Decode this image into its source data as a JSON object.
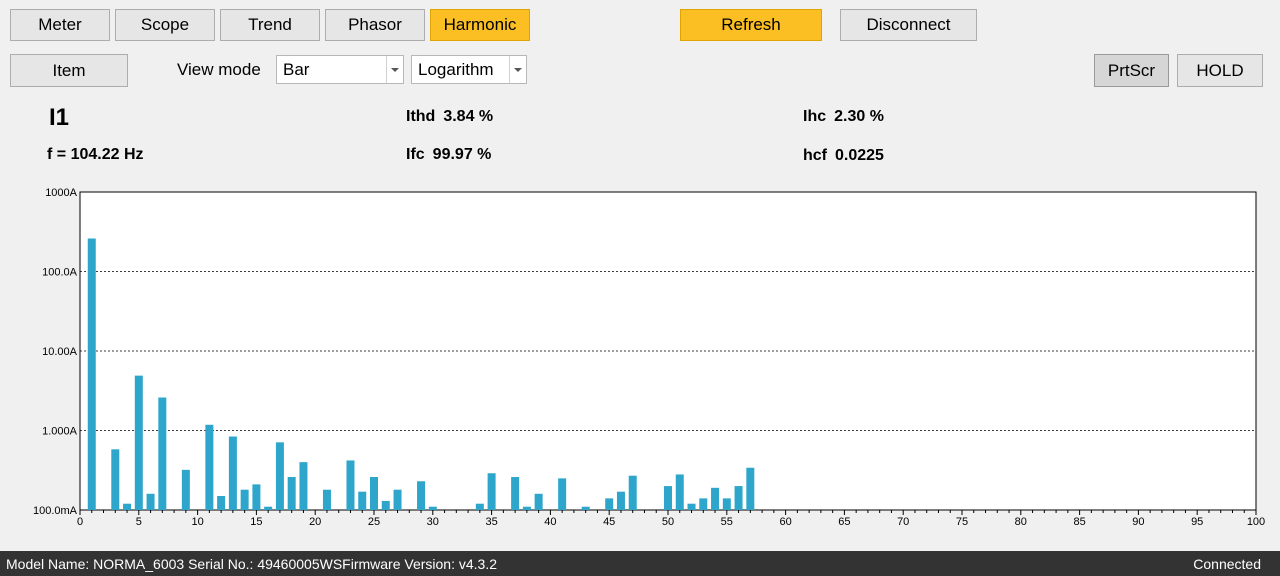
{
  "tabs": [
    {
      "label": "Meter",
      "active": false
    },
    {
      "label": "Scope",
      "active": false
    },
    {
      "label": "Trend",
      "active": false
    },
    {
      "label": "Phasor",
      "active": false
    },
    {
      "label": "Harmonic",
      "active": true
    }
  ],
  "top_buttons": {
    "refresh": "Refresh",
    "disconnect": "Disconnect"
  },
  "toolbar": {
    "item": "Item",
    "view_mode_label": "View mode",
    "view_mode_value": "Bar",
    "scale_value": "Logarithm",
    "prtscr": "PrtScr",
    "hold": "HOLD"
  },
  "readings": {
    "channel": "I1",
    "freq": "f = 104.22 Hz",
    "ithd_label": "Ithd",
    "ithd_value": "3.84 %",
    "ifc_label": "Ifc",
    "ifc_value": "99.97 %",
    "ihc_label": "Ihc",
    "ihc_value": "2.30 %",
    "hcf_label": "hcf",
    "hcf_value": "0.0225"
  },
  "colors": {
    "accent": "#fbbf24",
    "bar": "#2ea6cc",
    "statusbar": "#333333"
  },
  "chart_data": {
    "type": "bar",
    "yscale": "log",
    "ylim": [
      0.1,
      1000
    ],
    "xlim": [
      0,
      100
    ],
    "y_ticks": [
      0.1,
      1,
      10,
      100,
      1000
    ],
    "y_tick_labels": [
      "100.0mA",
      "1.000A",
      "10.00A",
      "100.0A",
      "1000A"
    ],
    "x_ticks": [
      0,
      5,
      10,
      15,
      20,
      25,
      30,
      35,
      40,
      45,
      50,
      55,
      60,
      65,
      70,
      75,
      80,
      85,
      90,
      95,
      100
    ],
    "x_tick_labels": [
      "0",
      "5",
      "10",
      "15",
      "20",
      "25",
      "30",
      "35",
      "40",
      "45",
      "50",
      "55",
      "60",
      "65",
      "70",
      "75",
      "80",
      "85",
      "90",
      "95",
      "100"
    ],
    "grid": true,
    "x": [
      1,
      2,
      3,
      4,
      5,
      6,
      7,
      8,
      9,
      10,
      11,
      12,
      13,
      14,
      15,
      16,
      17,
      18,
      19,
      20,
      21,
      22,
      23,
      24,
      25,
      26,
      27,
      28,
      29,
      30,
      31,
      32,
      33,
      34,
      35,
      36,
      37,
      38,
      39,
      40,
      41,
      42,
      43,
      44,
      45,
      46,
      47,
      48,
      49,
      50,
      51,
      52,
      53,
      54,
      55,
      56,
      57
    ],
    "values": [
      260,
      0.1,
      0.58,
      0.12,
      4.9,
      0.16,
      2.6,
      0.1,
      0.32,
      0.1,
      1.18,
      0.15,
      0.84,
      0.18,
      0.21,
      0.11,
      0.71,
      0.26,
      0.4,
      0.1,
      0.18,
      0.1,
      0.42,
      0.17,
      0.26,
      0.13,
      0.18,
      0.1,
      0.23,
      0.11,
      0.1,
      0.1,
      0.1,
      0.12,
      0.29,
      0.1,
      0.26,
      0.11,
      0.16,
      0.1,
      0.25,
      0.1,
      0.11,
      0.1,
      0.14,
      0.17,
      0.27,
      0.1,
      0.1,
      0.2,
      0.28,
      0.12,
      0.14,
      0.19,
      0.14,
      0.2,
      0.34
    ]
  },
  "status": {
    "info": "Model Name:  NORMA_6003 Serial No.:  49460005WSFirmware Version:  v4.3.2",
    "connection": "Connected"
  }
}
